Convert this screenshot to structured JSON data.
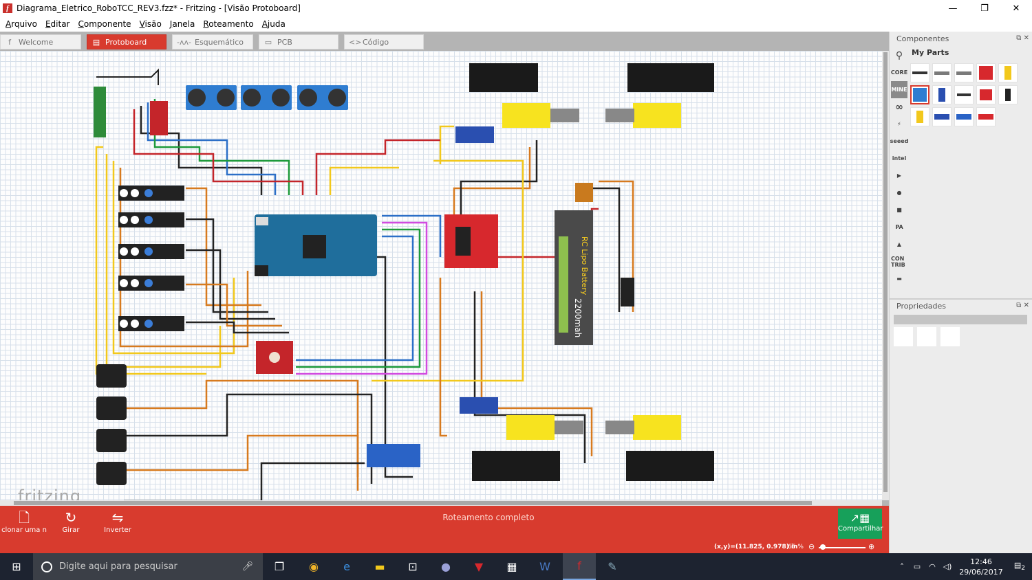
{
  "window": {
    "title": "Diagrama_Eletrico_RoboTCC_REV3.fzz* - Fritzing - [Visão Protoboard]",
    "app_icon_glyph": "f",
    "controls": [
      "—",
      "❐",
      "✕"
    ]
  },
  "menu": [
    {
      "label": "Arquivo",
      "accel": "A",
      "rest": "rquivo"
    },
    {
      "label": "Editar",
      "accel": "E",
      "rest": "ditar"
    },
    {
      "label": "Componente",
      "accel": "C",
      "rest": "omponente"
    },
    {
      "label": "Visão",
      "accel": "V",
      "rest": "isão"
    },
    {
      "label": "Janela",
      "accel": "J",
      "rest": "anela"
    },
    {
      "label": "Roteamento",
      "accel": "R",
      "rest": "oteamento"
    },
    {
      "label": "Ajuda",
      "accel": "A",
      "rest": "juda"
    }
  ],
  "tabs": [
    {
      "label": "Welcome",
      "icon": "fritzing-icon",
      "glyph": "f",
      "active": false
    },
    {
      "label": "Protoboard",
      "icon": "breadboard-icon",
      "glyph": "▤",
      "active": true
    },
    {
      "label": "Esquemático",
      "icon": "schematic-icon",
      "glyph": "-ʌʌ-",
      "active": false
    },
    {
      "label": "PCB",
      "icon": "pcb-icon",
      "glyph": "▭",
      "active": false
    },
    {
      "label": "Código",
      "icon": "code-icon",
      "glyph": "<>",
      "active": false
    }
  ],
  "canvas": {
    "logo": "fritzing",
    "battery_label": "RC Lipo Battery",
    "battery_capacity": "2200mah"
  },
  "toolbar": {
    "clone_label": "clonar uma n",
    "rotate_label": "Girar",
    "flip_label": "Inverter",
    "routing_status": "Roteamento completo",
    "share_label": "Compartilhar"
  },
  "status": {
    "coords": "(x,y)=(11.825, 0.978) in",
    "zoom": "66 %"
  },
  "parts_panel": {
    "title": "Componentes",
    "bin_title": "My Parts",
    "bins": [
      "search",
      "CORE",
      "MINE",
      "∞",
      "⚡",
      "seeed",
      "intel",
      "▶",
      "●",
      "■",
      "PA",
      "▲",
      "CON TRIB",
      "▬"
    ]
  },
  "props_panel": {
    "title": "Propriedades"
  },
  "taskbar": {
    "search_placeholder": "Digite aqui para pesquisar",
    "time": "12:46",
    "date": "29/06/2017",
    "notification_count": "2"
  },
  "colors": {
    "accent": "#d83b2e",
    "share": "#17a05a",
    "taskbar": "#1d2330"
  }
}
